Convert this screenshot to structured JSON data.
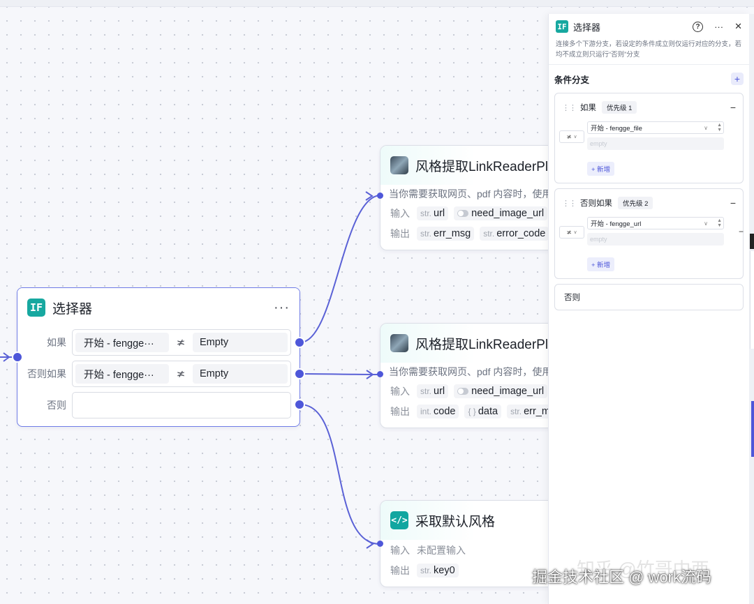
{
  "canvas": {
    "selector_node": {
      "title": "选择器",
      "more_label": "···",
      "rows": [
        {
          "label": "如果",
          "left": "开始 - fengge···",
          "op": "≭",
          "right": "Empty"
        },
        {
          "label": "否则如果",
          "left": "开始 - fengge···",
          "op": "≭",
          "right": "Empty"
        },
        {
          "label": "否则",
          "left": "",
          "op": "",
          "right": ""
        }
      ]
    },
    "plugin_node_1": {
      "title": "风格提取LinkReaderPlu",
      "desc": "当你需要获取网页、pdf 内容时，使用此",
      "input_label": "输入",
      "inputs": [
        {
          "type": "str.",
          "name": "url"
        },
        {
          "type": "toggle",
          "name": "need_image_url"
        }
      ],
      "output_label": "输出",
      "outputs": [
        {
          "type": "str.",
          "name": "err_msg"
        },
        {
          "type": "str.",
          "name": "error_code"
        }
      ]
    },
    "plugin_node_2": {
      "title": "风格提取LinkReaderPlu",
      "desc": "当你需要获取网页、pdf 内容时，使用此",
      "input_label": "输入",
      "inputs": [
        {
          "type": "str.",
          "name": "url"
        },
        {
          "type": "toggle",
          "name": "need_image_url"
        }
      ],
      "output_label": "输出",
      "outputs": [
        {
          "type": "int.",
          "name": "code"
        },
        {
          "type": "{ }",
          "name": "data"
        },
        {
          "type": "str.",
          "name": "err_m"
        }
      ]
    },
    "code_node": {
      "title": "采取默认风格",
      "input_label": "输入",
      "input_value": "未配置输入",
      "output_label": "输出",
      "outputs": [
        {
          "type": "str.",
          "name": "key0"
        }
      ]
    }
  },
  "panel": {
    "title": "选择器",
    "description": "连接多个下游分支，若设定的条件成立则仅运行对应的分支，若均不成立则只运行“否则”分支",
    "section_title": "条件分支",
    "add_label": "+",
    "branches": [
      {
        "label": "如果",
        "priority": "优先级 1",
        "variable": "开始 - fengge_file",
        "op": "≭",
        "placeholder": "empty",
        "new_label": "+ 新增"
      },
      {
        "label": "否则如果",
        "priority": "优先级 2",
        "variable": "开始 - fengge_url",
        "op": "≭",
        "placeholder": "empty",
        "new_label": "+ 新增"
      }
    ],
    "else_label": "否则"
  },
  "watermark": {
    "primary": "掘金技术社区 @ work流码",
    "secondary": "知乎 @竹哥中西"
  },
  "colors": {
    "accent": "#4e57d9",
    "node_icon_teal": "#17a8a0",
    "selected_border": "#6e7be6"
  }
}
